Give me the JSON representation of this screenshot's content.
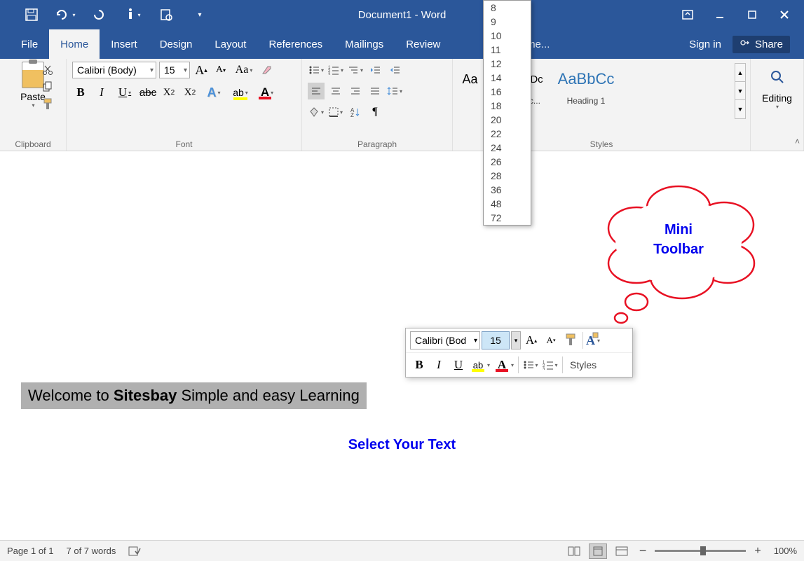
{
  "title": "Document1 - Word",
  "menu": {
    "file": "File",
    "home": "Home",
    "insert": "Insert",
    "design": "Design",
    "layout": "Layout",
    "references": "References",
    "mailings": "Mailings",
    "review": "Review",
    "tellme": "Tell me...",
    "signin": "Sign in",
    "share": "Share"
  },
  "ribbon": {
    "clipboard": {
      "paste": "Paste",
      "label": "Clipboard"
    },
    "font": {
      "name": "Calibri (Body)",
      "size": "15",
      "label": "Font",
      "caseAa": "Aa"
    },
    "paragraph": {
      "label": "Paragraph"
    },
    "styles": {
      "label": "Styles",
      "items": [
        {
          "preview": "Aa",
          "name": "",
          "cls": ""
        },
        {
          "preview": "AaBbCcDc",
          "name": "¶ No Spac...",
          "cls": ""
        },
        {
          "preview": "AaBbCc",
          "name": "Heading 1",
          "cls": "blue"
        }
      ]
    },
    "editing": {
      "label": "Editing"
    }
  },
  "sizelist": [
    "8",
    "9",
    "10",
    "11",
    "12",
    "14",
    "16",
    "18",
    "20",
    "22",
    "24",
    "26",
    "28",
    "36",
    "48",
    "72"
  ],
  "mini": {
    "font": "Calibri (Bod",
    "size": "15",
    "styles": "Styles"
  },
  "doc": {
    "line1a": "Welcome to ",
    "line1b": "Sitesbay",
    "line1c": " Simple and easy Learning",
    "instruction": "Select Your Text"
  },
  "cloud": {
    "l1": "Mini",
    "l2": "Toolbar"
  },
  "status": {
    "page": "Page 1 of 1",
    "words": "7 of 7 words",
    "zoom": "100%"
  }
}
